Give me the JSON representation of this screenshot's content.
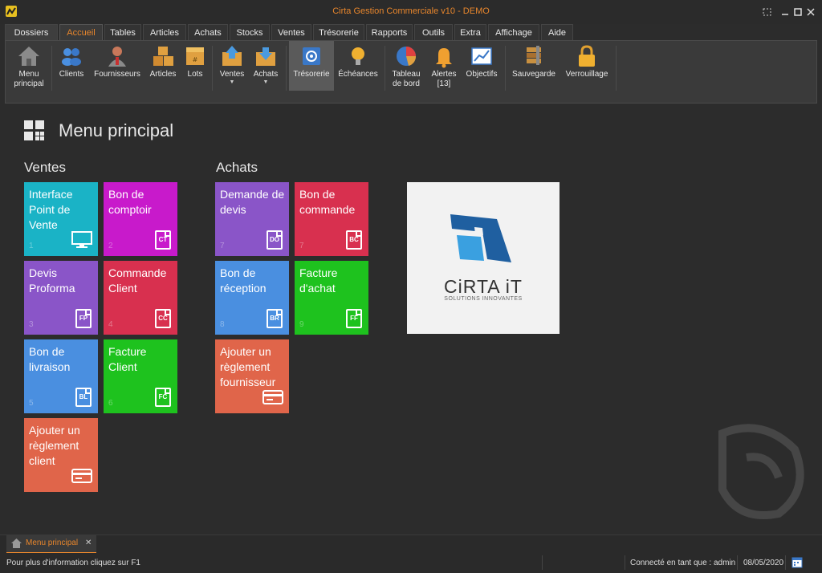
{
  "window": {
    "title": "Cirta Gestion Commerciale v10 - DEMO"
  },
  "menu_tabs": [
    "Dossiers",
    "Accueil",
    "Tables",
    "Articles",
    "Achats",
    "Stocks",
    "Ventes",
    "Trésorerie",
    "Rapports",
    "Outils",
    "Extra",
    "Affichage",
    "Aide"
  ],
  "active_tab": "Accueil",
  "ribbon": {
    "menu_principal": "Menu principal",
    "clients": "Clients",
    "fournisseurs": "Fournisseurs",
    "articles": "Articles",
    "lots": "Lots",
    "ventes": "Ventes",
    "achats": "Achats",
    "tresorerie": "Trésorerie",
    "echeances": "Échéances",
    "tableau_de_bord": "Tableau de bord",
    "alertes": "Alertes [13]",
    "objectifs": "Objectifs",
    "sauvegarde": "Sauvegarde",
    "verrouillage": "Verrouillage"
  },
  "page": {
    "title": "Menu principal",
    "ventes_heading": "Ventes",
    "achats_heading": "Achats"
  },
  "tiles": {
    "interface_pdv": {
      "label": "Interface Point de Vente",
      "num": "1",
      "color": "#1ab3c6"
    },
    "bon_comptoir": {
      "label": "Bon de comptoir",
      "num": "2",
      "abbr": "CT",
      "color": "#c81acb"
    },
    "devis_proforma": {
      "label": "Devis Proforma",
      "num": "3",
      "abbr": "FP",
      "color": "#8a55c8"
    },
    "commande_client": {
      "label": "Commande Client",
      "num": "4",
      "abbr": "CC",
      "color": "#d8304f"
    },
    "bon_livraison": {
      "label": "Bon de livraison",
      "num": "5",
      "abbr": "BL",
      "color": "#4a8fe0"
    },
    "facture_client": {
      "label": "Facture Client",
      "num": "6",
      "abbr": "FC",
      "color": "#1ec21e"
    },
    "reglement_client": {
      "label": "Ajouter un règlement client",
      "color": "#e0654a"
    },
    "demande_devis": {
      "label": "Demande de devis",
      "num": "7",
      "abbr": "DO",
      "color": "#8a55c8"
    },
    "bon_commande": {
      "label": "Bon de commande",
      "num": "7",
      "abbr": "BC",
      "color": "#d8304f"
    },
    "bon_reception": {
      "label": "Bon de réception",
      "num": "8",
      "abbr": "BR",
      "color": "#4a8fe0"
    },
    "facture_achat": {
      "label": "Facture d'achat",
      "num": "9",
      "abbr": "FF",
      "color": "#1ec21e"
    },
    "reglement_fournisseur": {
      "label": "Ajouter un règlement fournisseur",
      "color": "#e0654a"
    }
  },
  "logo": {
    "name": "CiRTA iT",
    "tagline": "SOLUTIONS INNOVANTES"
  },
  "doc_tab": {
    "label": "Menu principal",
    "close": "✕"
  },
  "status": {
    "help": "Pour plus d'information cliquez sur F1",
    "user": "Connecté en tant que : admin",
    "date": "08/05/2020"
  },
  "colors": {
    "accent": "#e8862c",
    "background": "#2c2c2c"
  }
}
